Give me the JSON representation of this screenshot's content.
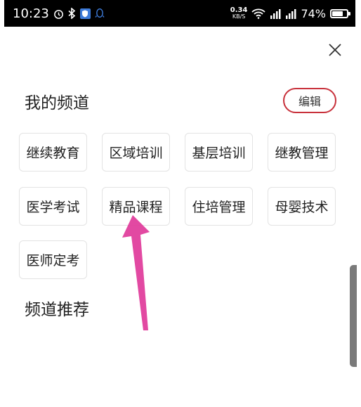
{
  "status_bar": {
    "time": "10:23",
    "alarm_icon": "alarm-clock-icon",
    "bluetooth_icon": "bluetooth-icon",
    "shield_icon": "security-shield-icon",
    "qq_icon": "qq-penguin-icon",
    "net_speed_value": "0.34",
    "net_speed_unit": "KB/S",
    "wifi_icon": "wifi-icon",
    "signal_icon_1": "signal-bars-icon",
    "signal_icon_2": "signal-4g-icon",
    "battery_percent": "74%",
    "battery_level": 0.74
  },
  "header": {
    "close_icon": "close-icon"
  },
  "my_channels": {
    "title": "我的频道",
    "edit_label": "编辑",
    "items": [
      {
        "label": "继续教育"
      },
      {
        "label": "区域培训"
      },
      {
        "label": "基层培训"
      },
      {
        "label": "继教管理"
      },
      {
        "label": "医学考试"
      },
      {
        "label": "精品课程"
      },
      {
        "label": "住培管理"
      },
      {
        "label": "母婴技术"
      },
      {
        "label": "医师定考"
      }
    ]
  },
  "recommended_channels": {
    "title": "频道推荐"
  },
  "colors": {
    "accent_red": "#c8313b",
    "annotation_pink": "#e0399a",
    "status_bar_bg": "#000000"
  }
}
